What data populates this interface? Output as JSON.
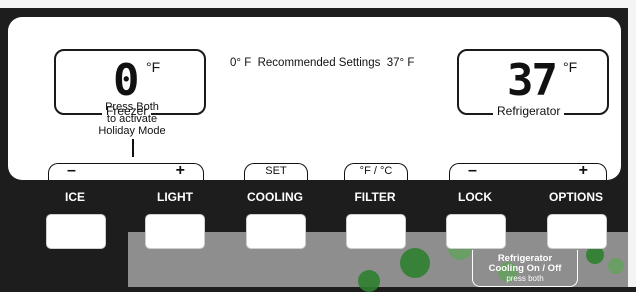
{
  "freezer": {
    "temp": "0",
    "unit": "F",
    "label": "Freezer",
    "note_lines": [
      "Press Both",
      "to activate",
      "Holiday Mode"
    ]
  },
  "recommended": {
    "freezer": "0° F",
    "title": "Recommended Settings",
    "fridge": "37° F"
  },
  "refrigerator": {
    "temp": "37",
    "unit": "F",
    "label": "Refrigerator"
  },
  "controls": {
    "minus": "–",
    "plus": "+",
    "set": "SET",
    "units": "°F / °C"
  },
  "keys": [
    "ICE",
    "LIGHT",
    "COOLING",
    "FILTER",
    "LOCK",
    "OPTIONS"
  ],
  "combo": {
    "line1": "Refrigerator",
    "line2": "Cooling On / Off",
    "line3": "press both"
  },
  "colors": {
    "panel": "#ffffff",
    "frame": "#1d1d1d",
    "key_text": "#ffffff"
  }
}
